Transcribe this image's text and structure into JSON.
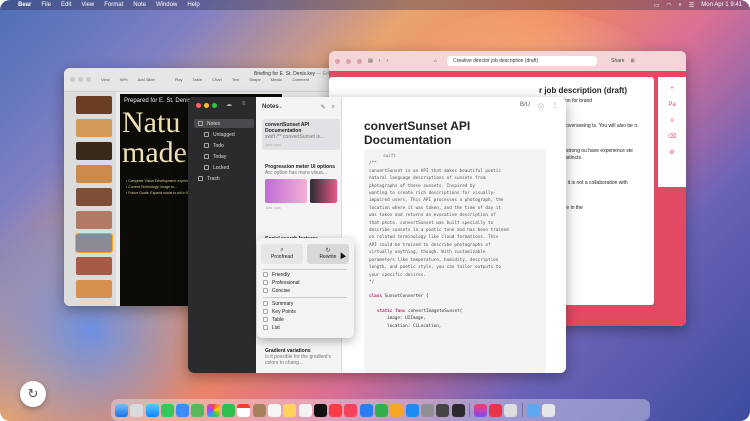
{
  "menubar": {
    "app": "Bear",
    "items": [
      "File",
      "Edit",
      "View",
      "Format",
      "Note",
      "Window",
      "Help"
    ],
    "clock": "Mon Apr 1  9:41"
  },
  "keynote": {
    "title": "Briefing for E. St. Denis.key",
    "edited": "— Edited",
    "toolbar": [
      "View",
      "Zoom",
      "Add Slide",
      "Play",
      "Table",
      "Chart",
      "Text",
      "Shape",
      "Media",
      "Comment",
      "Format",
      "Animate",
      "Document"
    ],
    "zoom": "90%",
    "slide_header": "Prepared for E. St. Denis",
    "slide_big_line1": "Natu",
    "slide_big_line2": "made",
    "bullets": [
      "• Computer Vision Development: experiencing to build innovative...",
      "• Current Technology: Image to...",
      "• Future Goals: Expand social to aid in the instantly ...avoiding"
    ]
  },
  "safari": {
    "url": "Creative director job description (draft)",
    "share": "Share",
    "heading": "r job description (draft)",
    "paragraphs": [
      "with a passion for brand",
      "ponsible for overseeing ts. You will also be n.",
      "igner with a strong ou have experience ste and visual instincts.",
      "vantageous, it is not a collaboration with",
      "erate in-office in the"
    ]
  },
  "bear": {
    "sidebar": [
      {
        "label": "Notes",
        "selected": true
      },
      {
        "label": "Untagged"
      },
      {
        "label": "Todo"
      },
      {
        "label": "Today"
      },
      {
        "label": "Locked"
      },
      {
        "label": "Trash"
      }
    ],
    "list_title": "Notes",
    "notes": [
      {
        "title": "convertSunset API Documentation",
        "preview": "swift /** convertSunset is...",
        "date": "Just now"
      },
      {
        "title": "Progression meter UI options",
        "preview": "Arc option has more visua...",
        "date": "Just now"
      },
      {
        "title": "Social search features",
        "preview": "",
        "date": ""
      },
      {
        "title": "Gradient variations",
        "preview": "Is it possible for the gradient's colors to chang...",
        "date": ""
      }
    ],
    "editor_tools": [
      "B/U",
      "ⓘ",
      "⋮"
    ],
    "note_title": "convertSunset API Documentation",
    "code_lang": "swift",
    "code_lines": [
      "/**",
      "convertSunset is an API that makes beautiful poetic",
      "natural language descriptions of sunsets from",
      "photographs of those sunsets. Inspired by",
      "wanting to create rich descriptions for visually-",
      "impaired users. This API processes a photograph, the",
      "location where it was taken, and the time of day it",
      "was taken and returns an evocative description of",
      "that photo. convertSunset was built specially to",
      "describe sunsets in a poetic tone and has been trained",
      "on related terminology like cloud formations. This",
      "API could be trained to describe photographs of",
      "virtually anything, though. With customizable",
      "parameters like temperature, humidity, description",
      "length, and poetic style, you can tailor outputs to",
      "your specific desires.",
      "*/"
    ],
    "code_class_kw": "class",
    "code_class_name": " SunsetConverter {",
    "code_func_kw": "static func",
    "code_func_name": " convertImagetoSunset(",
    "code_param1": "image: UIImage,",
    "code_param2": "location: CLLocation,"
  },
  "writing_tools": {
    "proofread": "Proofread",
    "rewrite": "Rewrite",
    "tones": [
      "Friendly",
      "Professional",
      "Concise"
    ],
    "formats": [
      "Summary",
      "Key Points",
      "Table",
      "List"
    ]
  }
}
